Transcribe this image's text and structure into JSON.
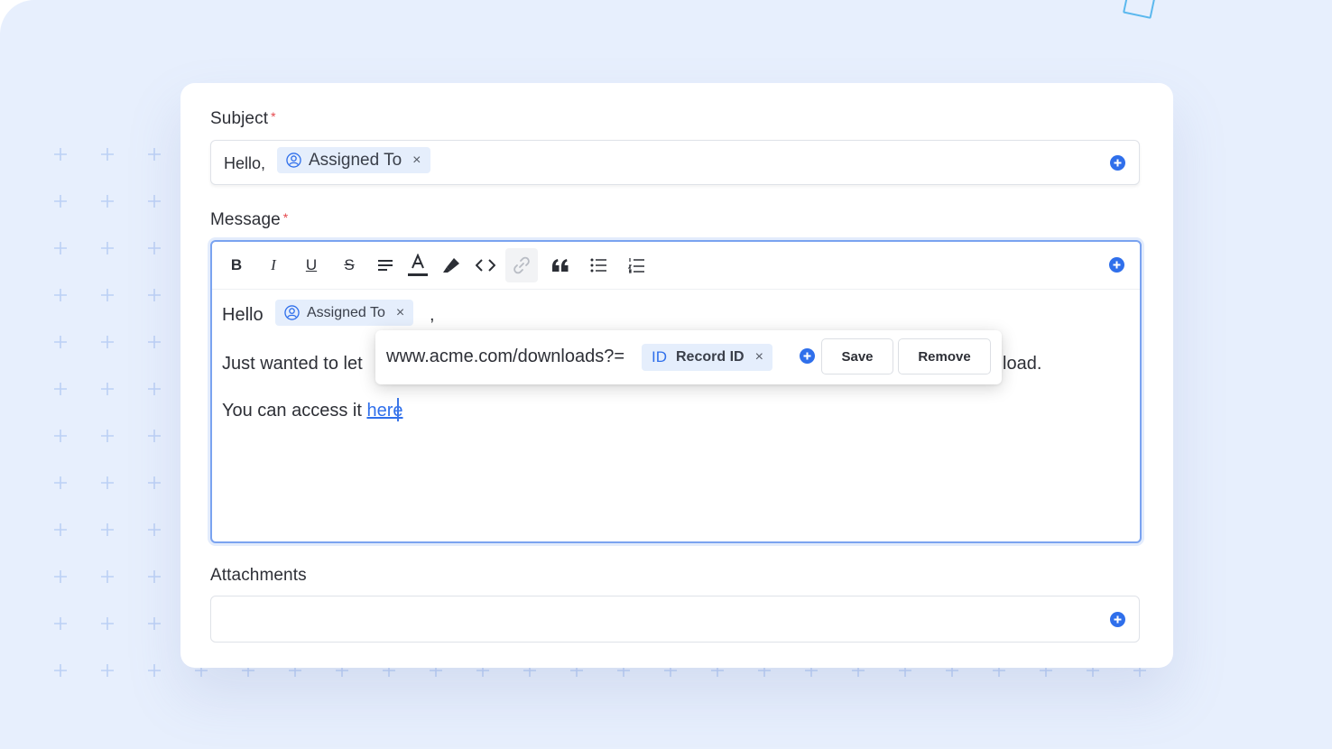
{
  "subject": {
    "label": "Subject",
    "required_mark": "*",
    "prefix_text": "Hello,",
    "chip_label": "Assigned To",
    "chip_remove": "×"
  },
  "message": {
    "label": "Message",
    "required_mark": "*",
    "toolbar": {
      "bold": "B",
      "italic": "I",
      "underline": "U",
      "strikethrough": "S"
    },
    "line1_greeting": "Hello",
    "line1_chip_label": "Assigned To",
    "line1_chip_remove": "×",
    "line1_comma": ",",
    "line2_start": "Just wanted to let",
    "line2_end": "load.",
    "line3_text": "You can access it ",
    "line3_link": "here"
  },
  "link_popup": {
    "url_text": "www.acme.com/downloads?=",
    "chip_icon_text": "ID",
    "chip_label": "Record ID",
    "chip_remove": "×",
    "save_label": "Save",
    "remove_label": "Remove"
  },
  "attachments": {
    "label": "Attachments"
  },
  "colors": {
    "accent": "#2f6feb",
    "chip_bg": "#e5eefc",
    "required": "#e5484d",
    "link": "#2f6feb",
    "background": "#e7effd"
  }
}
